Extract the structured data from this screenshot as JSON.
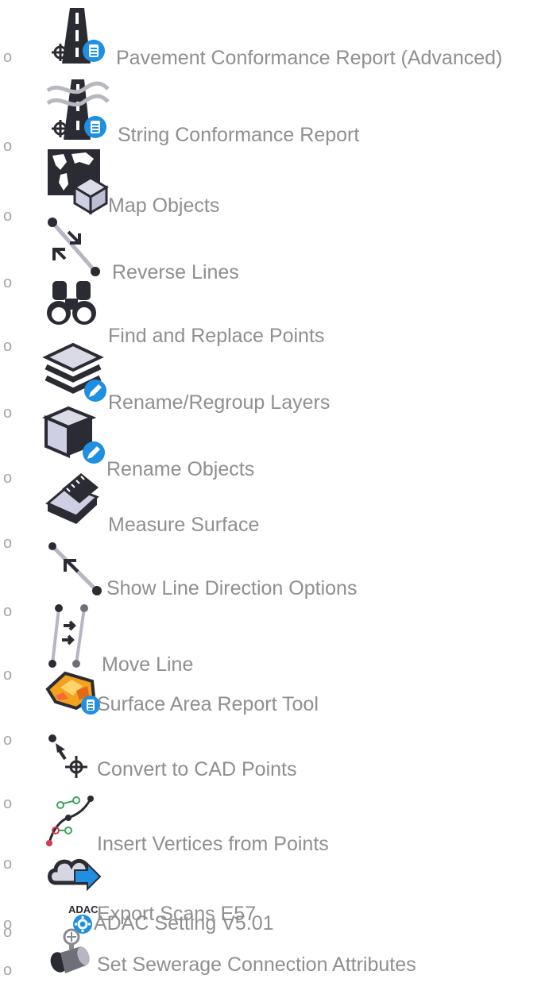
{
  "list": {
    "bullet": "o",
    "items": [
      {
        "label": "Pavement Conformance Report (Advanced)",
        "icon": "pavement-conformance-icon"
      },
      {
        "label": "String Conformance Report",
        "icon": "string-conformance-icon"
      },
      {
        "label": "Map Objects",
        "icon": "map-objects-icon"
      },
      {
        "label": "Reverse Lines",
        "icon": "reverse-lines-icon"
      },
      {
        "label": "Find and Replace Points",
        "icon": "binoculars-icon"
      },
      {
        "label": "Rename/Regroup Layers",
        "icon": "layers-edit-icon"
      },
      {
        "label": "Rename Objects",
        "icon": "cube-edit-icon"
      },
      {
        "label": "Measure Surface",
        "icon": "measure-surface-icon"
      },
      {
        "label": "Show Line Direction Options",
        "icon": "line-direction-icon"
      },
      {
        "label": "Move Line",
        "icon": "move-line-icon"
      },
      {
        "label": "Surface Area Report Tool",
        "icon": "surface-area-icon"
      },
      {
        "label": "Convert to CAD Points",
        "icon": "convert-cad-points-icon"
      },
      {
        "label": "Insert Vertices from Points",
        "icon": "insert-vertices-icon"
      },
      {
        "label": "Export Scans E57",
        "icon": "export-scans-icon"
      },
      {
        "label": "ADAC Setting V5.01",
        "icon": "adac-setting-icon",
        "icon_text": "ADAC"
      },
      {
        "label": "Set Sewerage Connection Attributes",
        "icon": "sewerage-connection-icon"
      }
    ]
  },
  "colors": {
    "text": "#8f8f8f",
    "icon_dark": "#2b2b33",
    "badge_blue": "#1e8fe1",
    "cube_face": "#cfcfe3"
  }
}
